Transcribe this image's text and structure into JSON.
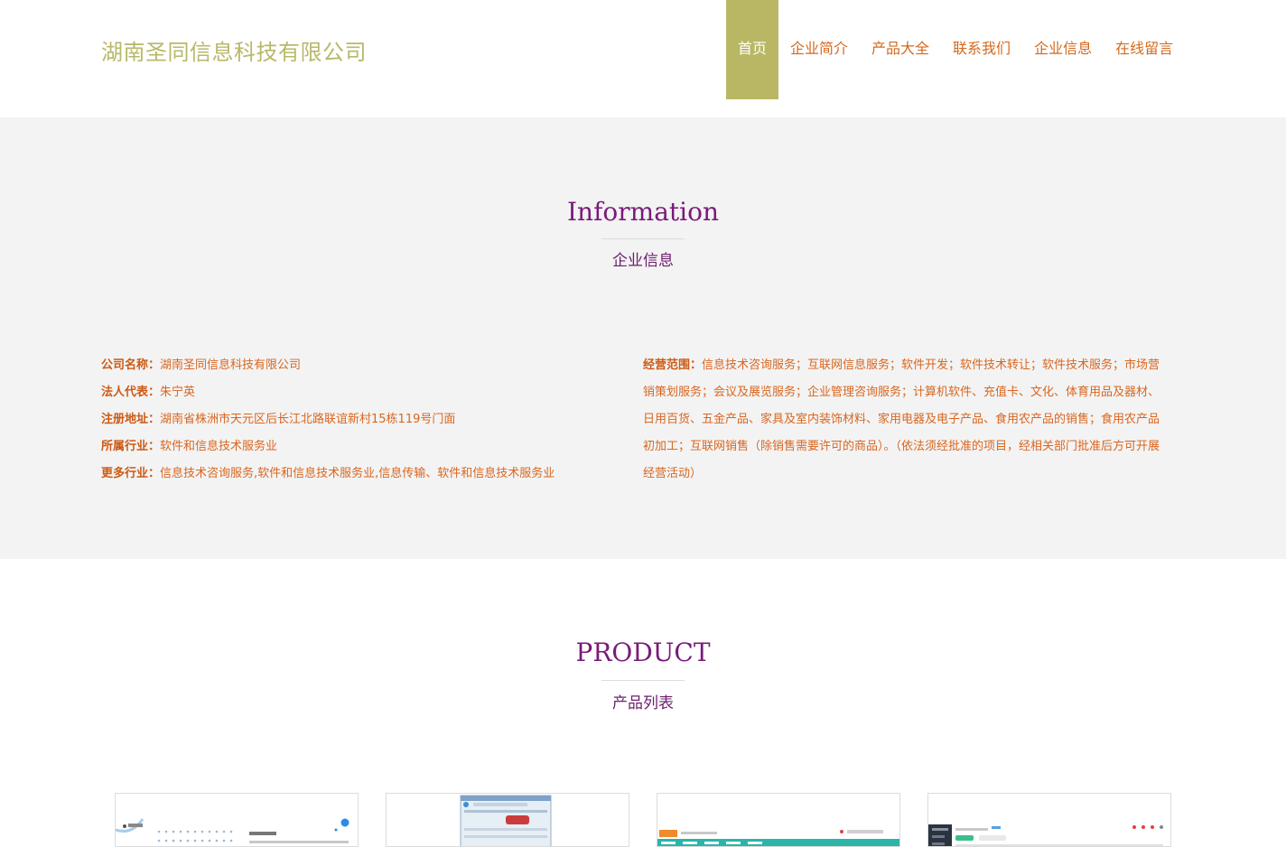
{
  "header": {
    "logo": "湖南圣同信息科技有限公司",
    "nav": [
      {
        "label": "首页",
        "active": true
      },
      {
        "label": "企业简介"
      },
      {
        "label": "产品大全"
      },
      {
        "label": "联系我们"
      },
      {
        "label": "企业信息"
      },
      {
        "label": "在线留言"
      }
    ]
  },
  "info": {
    "title": "Information",
    "subtitle": "企业信息",
    "left": [
      {
        "label": "公司名称：",
        "value": "湖南圣同信息科技有限公司"
      },
      {
        "label": "法人代表：",
        "value": "朱宁英"
      },
      {
        "label": "注册地址：",
        "value": "湖南省株洲市天元区后长江北路联谊新村15栋119号门面"
      },
      {
        "label": "所属行业：",
        "value": "软件和信息技术服务业"
      },
      {
        "label": "更多行业：",
        "value": "信息技术咨询服务,软件和信息技术服务业,信息传输、软件和信息技术服务业"
      }
    ],
    "scope_label": "经营范围：",
    "scope_text": "信息技术咨询服务；互联网信息服务；软件开发；软件技术转让；软件技术服务；市场营销策划服务；会议及展览服务；企业管理咨询服务；计算机软件、充值卡、文化、体育用品及器材、日用百货、五金产品、家具及室内装饰材料、家用电器及电子产品、食用农产品的销售；食用农产品初加工；互联网销售（除销售需要许可的商品）。（依法须经批准的项目，经相关部门批准后方可开展经营活动）"
  },
  "product": {
    "title": "PRODUCT",
    "subtitle": "产品列表"
  },
  "colors": {
    "logo": "#b8b86a",
    "nav_text": "#d4691e",
    "nav_active_bg": "#b9b764",
    "section_title": "#7a1a7a",
    "info_text": "#d9661f",
    "info_bg": "#f3f3f3"
  }
}
